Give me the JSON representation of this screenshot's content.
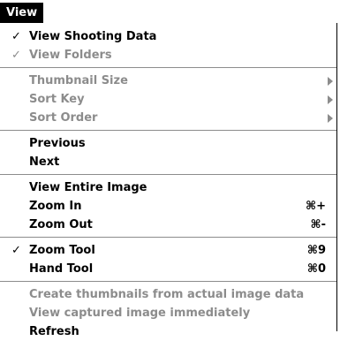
{
  "menubar": {
    "title": "View"
  },
  "menu": {
    "group1": [
      {
        "label": "View Shooting Data",
        "checked": true,
        "enabled": true
      },
      {
        "label": "View Folders",
        "checked": true,
        "enabled": false
      }
    ],
    "group2": [
      {
        "label": "Thumbnail Size",
        "enabled": false,
        "submenu": true
      },
      {
        "label": "Sort Key",
        "enabled": false,
        "submenu": true
      },
      {
        "label": "Sort Order",
        "enabled": false,
        "submenu": true
      }
    ],
    "group3": [
      {
        "label": "Previous",
        "enabled": true
      },
      {
        "label": "Next",
        "enabled": true
      }
    ],
    "group4": [
      {
        "label": "View Entire Image",
        "enabled": true
      },
      {
        "label": "Zoom In",
        "shortcut": "⌘+",
        "enabled": true
      },
      {
        "label": "Zoom Out",
        "shortcut": "⌘-",
        "enabled": true
      }
    ],
    "group5": [
      {
        "label": "Zoom Tool",
        "shortcut": "⌘9",
        "checked": true,
        "enabled": true
      },
      {
        "label": "Hand Tool",
        "shortcut": "⌘0",
        "enabled": true
      }
    ],
    "group6": [
      {
        "label": "Create thumbnails from actual image data",
        "enabled": false
      },
      {
        "label": "View captured image immediately",
        "enabled": false
      },
      {
        "label": "Refresh",
        "enabled": true
      }
    ],
    "check_glyph": "✓",
    "colors": {
      "disabled": "#8c8c8c",
      "highlight": "#000000"
    }
  }
}
